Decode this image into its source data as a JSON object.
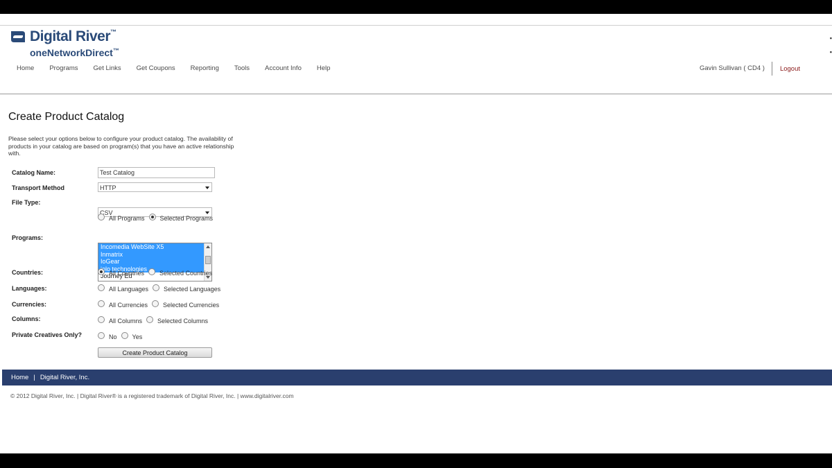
{
  "logo": {
    "brand": "Digital River",
    "product": "oneNetworkDirect"
  },
  "nav": [
    {
      "label": "Home"
    },
    {
      "label": "Programs"
    },
    {
      "label": "Get Links"
    },
    {
      "label": "Get Coupons"
    },
    {
      "label": "Reporting"
    },
    {
      "label": "Tools"
    },
    {
      "label": "Account Info"
    },
    {
      "label": "Help"
    }
  ],
  "user": {
    "name": "Gavin Sullivan ( CD4 )",
    "logout_label": "Logout"
  },
  "page": {
    "title": "Create Product Catalog",
    "intro": "Please select your options below to configure your product catalog. The availability of products in your catalog are based on program(s) that you have an active relationship with."
  },
  "form": {
    "catalog_name": {
      "label": "Catalog Name:",
      "value": "Test Catalog"
    },
    "transport_method": {
      "label": "Transport Method",
      "value": "HTTP"
    },
    "file_type": {
      "label": "File Type:",
      "value": "CSV"
    },
    "programs": {
      "label": "Programs:",
      "options": [
        {
          "label": "All Programs",
          "selected": false
        },
        {
          "label": "Selected Programs",
          "selected": true
        }
      ],
      "list": [
        {
          "label": "Incomedia WebSite X5",
          "selected": true
        },
        {
          "label": "Inmatrix",
          "selected": true
        },
        {
          "label": "IoGear",
          "selected": true
        },
        {
          "label": "iolo technologies",
          "selected": true
        },
        {
          "label": "Journey Ed",
          "selected": false
        }
      ]
    },
    "countries": {
      "label": "Countries:",
      "options": [
        {
          "label": "All Countries",
          "selected": true
        },
        {
          "label": "Selected Countries",
          "selected": false
        }
      ]
    },
    "languages": {
      "label": "Languages:",
      "options": [
        {
          "label": "All Languages",
          "selected": false
        },
        {
          "label": "Selected Languages",
          "selected": false
        }
      ]
    },
    "currencies": {
      "label": "Currencies:",
      "options": [
        {
          "label": "All Currencies",
          "selected": false
        },
        {
          "label": "Selected Currencies",
          "selected": false
        }
      ]
    },
    "columns": {
      "label": "Columns:",
      "options": [
        {
          "label": "All Columns",
          "selected": false
        },
        {
          "label": "Selected Columns",
          "selected": false
        }
      ]
    },
    "private_creatives": {
      "label": "Private Creatives Only?",
      "options": [
        {
          "label": "No",
          "selected": false
        },
        {
          "label": "Yes",
          "selected": false
        }
      ]
    },
    "submit_label": "Create Product Catalog"
  },
  "footer": {
    "links": [
      {
        "label": "Home"
      },
      {
        "label": "Digital River, Inc."
      }
    ],
    "separator": "|",
    "copyright": "© 2012 Digital River, Inc. | Digital River® is a registered trademark of Digital River, Inc. | www.digitalriver.com"
  },
  "colors": {
    "brand_blue": "#2a4a78",
    "footer_bar": "#2a3f6e",
    "selection": "#3399ff",
    "logout": "#8a1818"
  }
}
